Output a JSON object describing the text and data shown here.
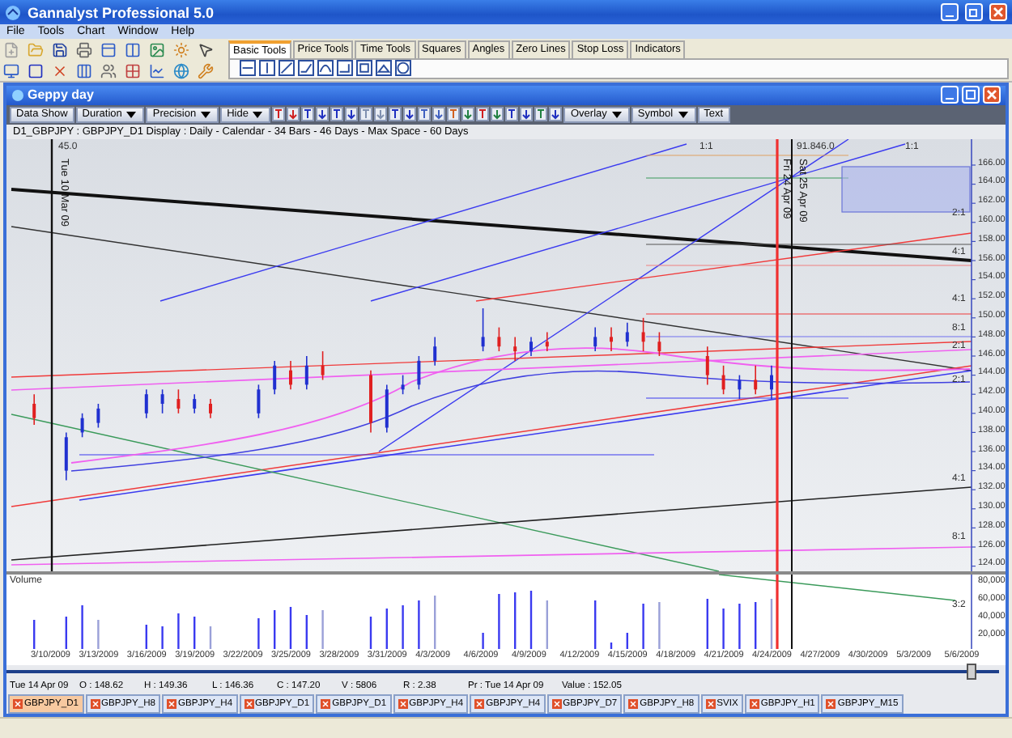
{
  "app_title": "Gannalyst Professional 5.0",
  "menu": [
    "File",
    "Tools",
    "Chart",
    "Window",
    "Help"
  ],
  "tool_tabs": [
    {
      "label": "Basic Tools",
      "selected": true
    },
    {
      "label": "Price Tools",
      "selected": false
    },
    {
      "label": "Time Tools",
      "selected": false
    },
    {
      "label": "Squares",
      "selected": false
    },
    {
      "label": "Angles",
      "selected": false
    },
    {
      "label": "Zero Lines",
      "selected": false
    },
    {
      "label": "Stop Loss",
      "selected": false
    },
    {
      "label": "Indicators",
      "selected": false
    }
  ],
  "chart_window": {
    "title": "Geppy day",
    "toolbar": [
      {
        "label": "Data Show",
        "kind": "button"
      },
      {
        "label": "Duration",
        "kind": "dropdown"
      },
      {
        "label": "Precision",
        "kind": "dropdown"
      },
      {
        "label": "Hide",
        "kind": "dropdown"
      },
      {
        "kind": "icons"
      },
      {
        "label": "Overlay",
        "kind": "dropdown"
      },
      {
        "label": "Symbol",
        "kind": "dropdown"
      },
      {
        "label": "Text",
        "kind": "button"
      }
    ],
    "info": "D1_GBPJPY : GBPJPY_D1 Display :  Daily  - Calendar - 34 Bars - 46 Days -  Max Space - 60 Days",
    "top_labels": [
      "45.0",
      "1:1",
      "91.846.0",
      "1:1"
    ],
    "ratio_labels": [
      "2:1",
      "4:1",
      "4:1",
      "8:1",
      "2:1",
      "2:1",
      "4:1",
      "8:1"
    ],
    "vertical_labels": [
      "Tue 10 Mar 09",
      "Fri 24 Apr 09",
      "Sat 25 Apr 09"
    ],
    "price_axis": [
      "166.00",
      "164.00",
      "162.00",
      "160.00",
      "158.00",
      "156.00",
      "154.00",
      "152.00",
      "150.00",
      "148.00",
      "146.00",
      "144.00",
      "142.00",
      "140.00",
      "138.00",
      "136.00",
      "134.00",
      "132.00",
      "130.00",
      "128.00",
      "126.00",
      "124.00"
    ],
    "volume_label": "Volume",
    "volume_ratio_label": "3:2",
    "volume_axis": [
      "80,000",
      "60,000",
      "40,000",
      "20,000"
    ],
    "date_axis": [
      "3/10/2009",
      "3/13/2009",
      "3/16/2009",
      "3/19/2009",
      "3/22/2009",
      "3/25/2009",
      "3/28/2009",
      "3/31/2009",
      "4/3/2009",
      "4/6/2009",
      "4/9/2009",
      "4/12/2009",
      "4/15/2009",
      "4/18/2009",
      "4/21/2009",
      "4/24/2009",
      "4/27/2009",
      "4/30/2009",
      "5/3/2009",
      "5/6/2009"
    ],
    "status": [
      "Tue 14 Apr 09",
      "O : 148.62",
      "H : 149.36",
      "L : 146.36",
      "C : 147.20",
      "V : 5806",
      "R : 2.38",
      "Pr : Tue 14 Apr 09",
      "Value : 152.05"
    ],
    "symbol_tabs": [
      {
        "label": "GBPJPY_D1",
        "selected": true
      },
      {
        "label": "GBPJPY_H8",
        "selected": false
      },
      {
        "label": "GBPJPY_H4",
        "selected": false
      },
      {
        "label": "GBPJPY_D1",
        "selected": false
      },
      {
        "label": "GBPJPY_D1",
        "selected": false
      },
      {
        "label": "GBPJPY_H4",
        "selected": false
      },
      {
        "label": "GBPJPY_H4",
        "selected": false
      },
      {
        "label": "GBPJPY_D7",
        "selected": false
      },
      {
        "label": "GBPJPY_H8",
        "selected": false
      },
      {
        "label": "SVIX",
        "selected": false
      },
      {
        "label": "GBPJPY_H1",
        "selected": false
      },
      {
        "label": "GBPJPY_M15",
        "selected": false
      }
    ]
  }
}
